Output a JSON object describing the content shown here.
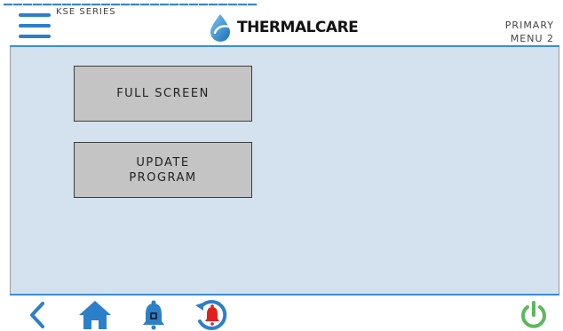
{
  "header": {
    "series": "KSE SERIES",
    "brand": "THERMALCARE",
    "menu_title_line1": "PRIMARY",
    "menu_title_line2": "MENU 2"
  },
  "main": {
    "full_screen_label": "FULL SCREEN",
    "update_program_label": "UPDATE\nPROGRAM"
  },
  "footer": {
    "icons": [
      "back-arrow-icon",
      "home-icon",
      "alarm-bell-icon",
      "alarm-history-icon",
      "power-icon"
    ]
  },
  "colors": {
    "accent_blue": "#2c7fc9",
    "panel_background": "#d4e2ef",
    "button_gray": "#c4c4c4",
    "power_green": "#5cb85c",
    "alarm_red": "#e02020"
  }
}
